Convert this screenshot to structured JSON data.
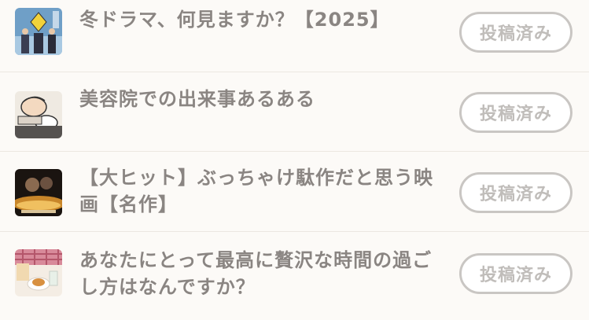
{
  "items": [
    {
      "title": "冬ドラマ、何見ますか？【2025】",
      "button_label": "投稿済み",
      "thumb_icon": "drama-poster-thumbnail"
    },
    {
      "title": "美容院での出来事あるある",
      "button_label": "投稿済み",
      "thumb_icon": "beauty-salon-illustration-thumbnail"
    },
    {
      "title": "【大ヒット】ぶっちゃけ駄作だと思う映画【名作】",
      "button_label": "投稿済み",
      "thumb_icon": "movie-poster-thumbnail"
    },
    {
      "title": "あなたにとって最高に贅沢な時間の過ごし方はなんですか？",
      "button_label": "投稿済み",
      "thumb_icon": "tea-table-photo-thumbnail"
    }
  ]
}
